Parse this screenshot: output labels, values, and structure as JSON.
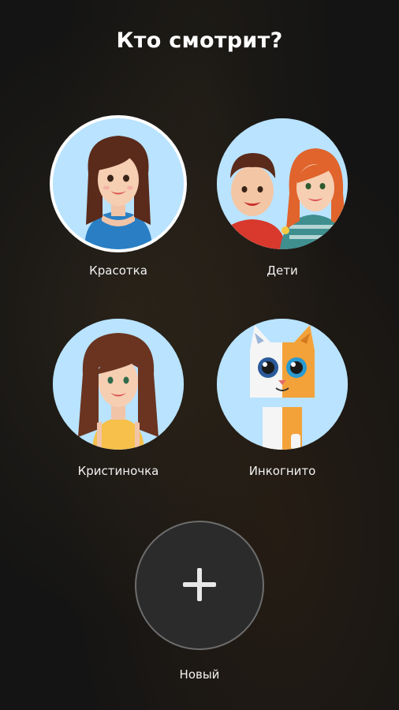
{
  "header": {
    "title": "Кто смотрит?"
  },
  "profiles": [
    {
      "label": "Красотка",
      "avatar_icon": "woman-avatar-icon",
      "selected": true
    },
    {
      "label": "Дети",
      "avatar_icon": "kids-avatar-icon",
      "selected": false
    },
    {
      "label": "Кристиночка",
      "avatar_icon": "girl-avatar-icon",
      "selected": false
    },
    {
      "label": "Инкогнито",
      "avatar_icon": "cat-avatar-icon",
      "selected": false
    }
  ],
  "add_profile": {
    "label": "Новый",
    "icon": "plus-icon"
  },
  "colors": {
    "background": "#141414",
    "avatar_bg": "#aee0ff",
    "add_button_bg": "#2b2b2b"
  }
}
